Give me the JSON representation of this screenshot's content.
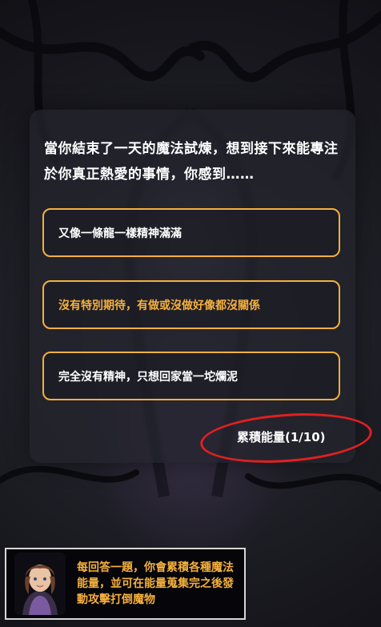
{
  "question": {
    "text": "當你結束了一天的魔法試煉，想到接下來能專注於你真正熱愛的事情，你感到……"
  },
  "options": [
    {
      "label": "又像一條龍一樣精神滿滿"
    },
    {
      "label": "沒有特別期待，有做或沒做好像都沒關係"
    },
    {
      "label": "完全沒有精神，只想回家當一坨爛泥"
    }
  ],
  "energy": {
    "label": "累積能量(1/10)"
  },
  "tip": {
    "text": "每回答一題，你會累積各種魔法能量，並可在能量蒐集完之後發動攻擊打倒魔物"
  },
  "colors": {
    "accent": "#f4b03d",
    "highlight": "#e02020",
    "card": "#24242e"
  },
  "icons": {
    "avatar": "mage-portrait"
  }
}
